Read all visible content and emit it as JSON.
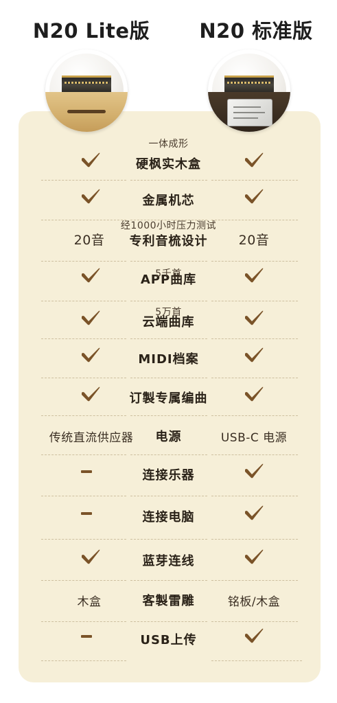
{
  "header": {
    "left_title": "N20 Lite版",
    "right_title": "N20 标准版"
  },
  "colors": {
    "card_bg": "#f6efd8",
    "check": "#7a5328",
    "text": "#2a2218"
  },
  "rows": [
    {
      "sub": "一体成形",
      "feature": "硬枫实木盒",
      "left": "check",
      "right": "check"
    },
    {
      "sub": "",
      "feature": "金属机芯",
      "left": "check",
      "right": "check"
    },
    {
      "sub": "经1000小时压力测试",
      "feature": "专利音梳设计",
      "left_text": "20音",
      "right_text": "20音"
    },
    {
      "sub": "5千首",
      "feature": "APP曲库",
      "left": "check",
      "right": "check"
    },
    {
      "sub": "5万首",
      "feature": "云端曲库",
      "left": "check",
      "right": "check"
    },
    {
      "sub": "",
      "feature": "MIDI档案",
      "left": "check",
      "right": "check"
    },
    {
      "sub": "",
      "feature": "订製专属编曲",
      "left": "check",
      "right": "check"
    },
    {
      "sub": "",
      "feature": "电源",
      "left_text": "传统直流供应器",
      "right_text": "USB-C 电源"
    },
    {
      "sub": "",
      "feature": "连接乐器",
      "left": "dash",
      "right": "check"
    },
    {
      "sub": "",
      "feature": "连接电脑",
      "left": "dash",
      "right": "check"
    },
    {
      "sub": "",
      "feature": "蓝芽连线",
      "left": "check",
      "right": "check"
    },
    {
      "sub": "",
      "feature": "客製雷雕",
      "left_text": "木盒",
      "right_text": "铭板/木盒"
    },
    {
      "sub": "",
      "feature": "USB上传",
      "left": "dash",
      "right": "check"
    }
  ]
}
